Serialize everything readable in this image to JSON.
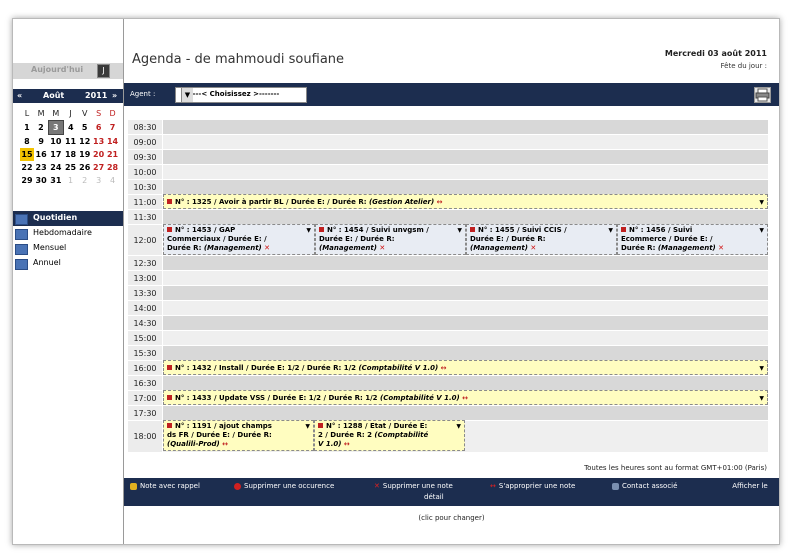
{
  "sidebar": {
    "today_label": "Aujourd'hui",
    "today_button": "J",
    "calendar": {
      "prev": "«",
      "month": "Août",
      "year": "2011",
      "next": "»",
      "weekdays": [
        "L",
        "M",
        "M",
        "J",
        "V",
        "S",
        "D"
      ],
      "weeks": [
        [
          "1",
          "2",
          "3",
          "4",
          "5",
          "6",
          "7"
        ],
        [
          "8",
          "9",
          "10",
          "11",
          "12",
          "13",
          "14"
        ],
        [
          "15",
          "16",
          "17",
          "18",
          "19",
          "20",
          "21"
        ],
        [
          "22",
          "23",
          "24",
          "25",
          "26",
          "27",
          "28"
        ],
        [
          "29",
          "30",
          "31",
          "1",
          "2",
          "3",
          "4"
        ]
      ]
    },
    "views": [
      {
        "label": "Quotidien",
        "icon": "day-view-icon"
      },
      {
        "label": "Hebdomadaire",
        "icon": "week-view-icon"
      },
      {
        "label": "Mensuel",
        "icon": "month-view-icon"
      },
      {
        "label": "Annuel",
        "icon": "year-view-icon"
      }
    ]
  },
  "header": {
    "title": "Agenda - de mahmoudi soufiane",
    "date": "Mercredi 03 août 2011",
    "fete": "Fête du jour :"
  },
  "agent_bar": {
    "label": "Agent :",
    "select_value": "-------< Choisissez >-------",
    "print_icon": "print-icon"
  },
  "times": [
    "08:30",
    "09:00",
    "09:30",
    "10:00",
    "10:30",
    "11:00",
    "11:30",
    "12:00",
    "12:30",
    "13:00",
    "13:30",
    "14:00",
    "14:30",
    "15:00",
    "15:30",
    "16:00",
    "16:30",
    "17:00",
    "17:30",
    "18:00"
  ],
  "events": {
    "e1325": {
      "text": "N° : 1325 / Avoir à partir BL / Durée E: / Durée R: ",
      "cat": "(Gestion Atelier)"
    },
    "e1453": {
      "line1": "N° : 1453 / GAP",
      "line2": "Commerciaux / Durée E: /",
      "line3": "Durée R: ",
      "cat": "(Management)"
    },
    "e1454": {
      "line1": "N° : 1454 / Suivi unvgsm /",
      "line2": "Durée E: / Durée R:",
      "cat": "(Management)"
    },
    "e1455": {
      "line1": "N° : 1455 / Suivi CCIS /",
      "line2": "Durée E: / Durée R:",
      "cat": "(Management)"
    },
    "e1456": {
      "line1": "N° : 1456 / Suivi",
      "line2": "Ecommerce / Durée E: /",
      "line3": "Durée R: ",
      "cat": "(Management)"
    },
    "e1432": {
      "text": "N° : 1432 / Install / Durée E: 1/2 / Durée R: 1/2 ",
      "cat": "(Comptabilité V 1.0)"
    },
    "e1433": {
      "text": "N° : 1433 / Update VSS / Durée E: 1/2 / Durée R: 1/2 ",
      "cat": "(Comptabilité V 1.0)"
    },
    "e1191": {
      "line1": "N° : 1191 / ajout champs",
      "line2": "ds FR / Durée E: / Durée R:",
      "cat": "(Qualili-Prod)"
    },
    "e1288": {
      "line1": "N° : 1288 / Etat / Durée E:",
      "line2": "2 / Durée R: 2 ",
      "cat2": "(Comptabilité",
      "cat3": "V 1.0)"
    }
  },
  "tz_note": "Toutes les heures sont au format GMT+01:00 (Paris)",
  "legend": {
    "rappel": "Note avec rappel",
    "supprimer_occ": "Supprimer une occurence",
    "supprimer_note": "Supprimer une note",
    "approprier": "S'approprier une note",
    "contact": "Contact associé",
    "afficher_line1": "Afficher le",
    "afficher_line2": "détail"
  },
  "change_note": "(clic pour changer)"
}
